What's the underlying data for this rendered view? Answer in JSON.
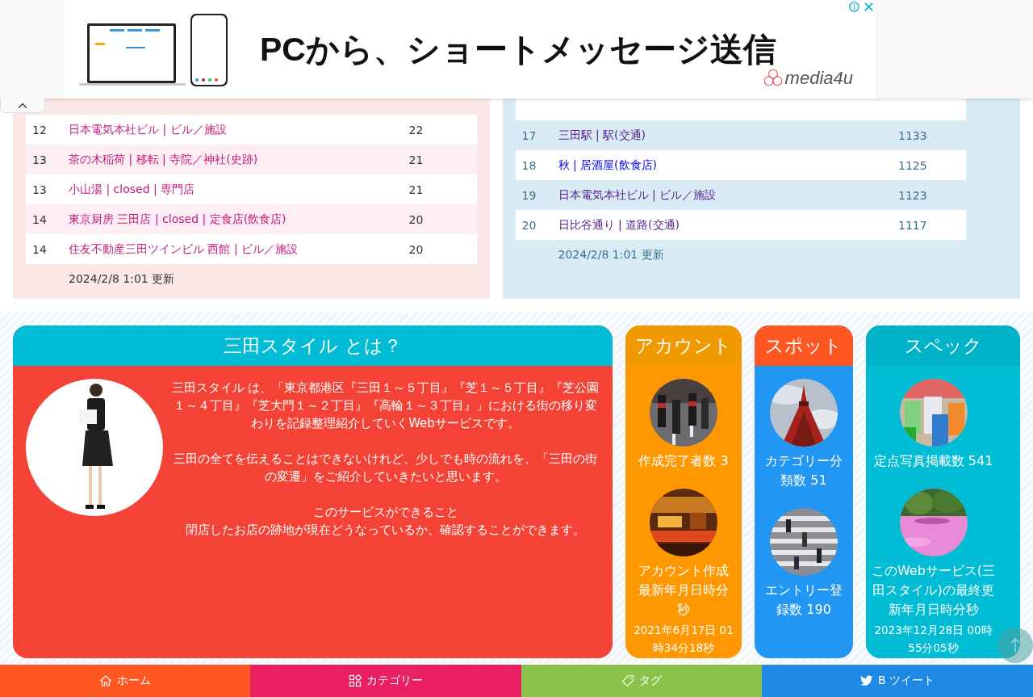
{
  "ad": {
    "headline": "PCから、ショートメッセージ送信",
    "brand": "media4u"
  },
  "left_ranking": {
    "rows": [
      {
        "rank": "12",
        "title": "日本電気本社ビル | ビル／施設",
        "count": "22"
      },
      {
        "rank": "13",
        "title": "茶の木稲荷 | 移転 | 寺院／神社(史跡)",
        "count": "21"
      },
      {
        "rank": "13",
        "title": "小山湯 | closed | 専門店",
        "count": "21"
      },
      {
        "rank": "14",
        "title": "東京厨房 三田店 | closed | 定食店(飲食店)",
        "count": "20"
      },
      {
        "rank": "14",
        "title": "住友不動産三田ツインビル 西館 | ビル／施設",
        "count": "20"
      }
    ],
    "updated": "2024/2/8 1:01 更新"
  },
  "right_ranking": {
    "rows": [
      {
        "rank": "17",
        "title": "三田駅 | 駅(交通)",
        "count": "1133",
        "visited": true
      },
      {
        "rank": "18",
        "title": "秋 | 居酒屋(飲食店)",
        "count": "1125",
        "visited": false
      },
      {
        "rank": "19",
        "title": "日本電気本社ビル | ビル／施設",
        "count": "1123",
        "visited": true
      },
      {
        "rank": "20",
        "title": "日比谷通り | 道路(交通)",
        "count": "1117",
        "visited": true
      }
    ],
    "updated": "2024/2/8 1:01 更新"
  },
  "about": {
    "title": "三田スタイル とは？",
    "paragraphs": [
      "三田スタイル は、「東京都港区『三田１～５丁目』『芝１～５丁目』『芝公園１～４丁目』『芝大門１～２丁目』『高輪１～３丁目』」における街の移り変わりを記録整理紹介していくWebサービスです。",
      "三田の全てを伝えることはできないけれど、少しでも時の流れを、「三田の街の変遷」をご紹介していきたいと思います。",
      "このサービスができること",
      "閉店したお店の跡地が現在どうなっているか、確認することができます。"
    ]
  },
  "stat_cards": [
    {
      "kind": "account",
      "title": "アカウント",
      "items": [
        {
          "label": "作成完了者数 3"
        },
        {
          "label": "アカウント作成最新年月日時分秒",
          "detail": "2021年6月17日 01時34分18秒"
        }
      ]
    },
    {
      "kind": "spot",
      "title": "スポット",
      "items": [
        {
          "label": "カテゴリー分類数 51"
        },
        {
          "label": "エントリー登録数 190"
        }
      ]
    },
    {
      "kind": "spec",
      "title": "スペック",
      "items": [
        {
          "label": "定点写真掲載数 541"
        },
        {
          "label": "このWebサービス(三田スタイル)の最終更新年月日時分秒",
          "detail": "2023年12月28日 00時55分05秒"
        }
      ]
    }
  ],
  "nav": [
    {
      "kind": "home",
      "label": "ホーム"
    },
    {
      "kind": "category",
      "label": "カテゴリー"
    },
    {
      "kind": "tag",
      "label": "タグ"
    },
    {
      "kind": "tweet",
      "label": "B ツイート"
    }
  ]
}
